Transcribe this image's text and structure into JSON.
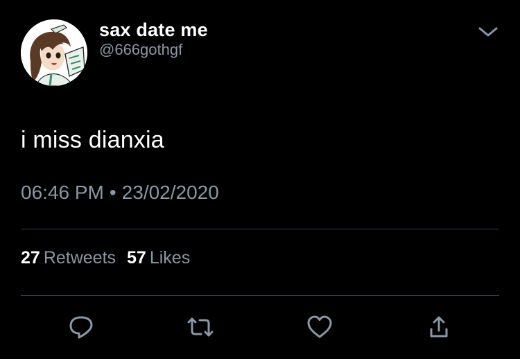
{
  "user": {
    "display_name": "sax date me",
    "handle": "@666gothgf"
  },
  "tweet": {
    "text": "i miss dianxia",
    "time": "06:46 PM",
    "separator": "•",
    "date": "23/02/2020"
  },
  "stats": {
    "retweets_count": "27",
    "retweets_label": "Retweets",
    "likes_count": "57",
    "likes_label": "Likes"
  },
  "icons": {
    "menu": "chevron-down-icon",
    "reply": "reply-icon",
    "retweet": "retweet-icon",
    "like": "heart-icon",
    "share": "share-icon"
  },
  "colors": {
    "background": "#000000",
    "text_primary": "#ffffff",
    "text_secondary": "#8b98a5",
    "divider": "#38444d",
    "icon": "#8b98a5"
  }
}
